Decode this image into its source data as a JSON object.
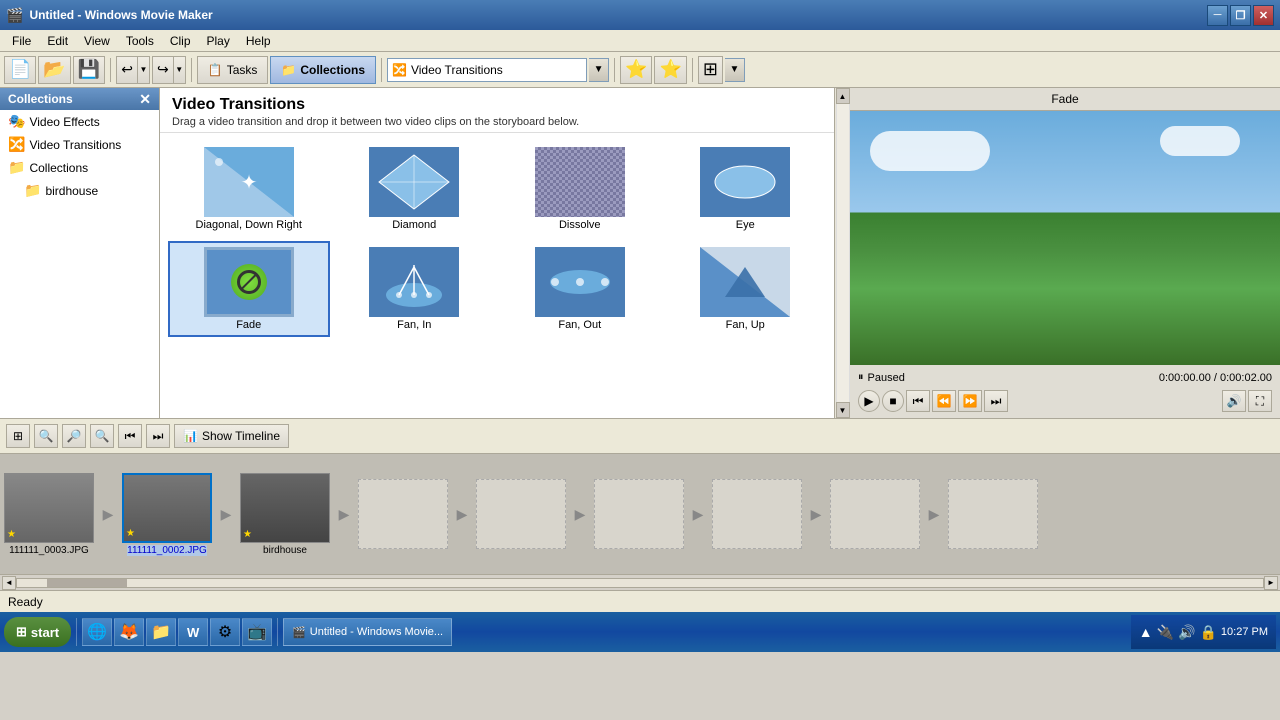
{
  "window": {
    "title": "Untitled - Windows Movie Maker",
    "icon": "🎬"
  },
  "title_bar": {
    "title": "Untitled - Windows Movie Maker",
    "minimize": "─",
    "restore": "❐",
    "close": "✕"
  },
  "menu": {
    "items": [
      "File",
      "Edit",
      "View",
      "Tools",
      "Clip",
      "Play",
      "Help"
    ]
  },
  "toolbar": {
    "tasks_label": "Tasks",
    "collections_label": "Collections",
    "dropdown_value": "Video Transitions",
    "new_icon": "📄",
    "open_icon": "📂",
    "save_icon": "💾",
    "undo_icon": "↩",
    "redo_icon": "↪",
    "import_icon": "⭐",
    "import2_icon": "⭐"
  },
  "left_panel": {
    "title": "Collections",
    "close_icon": "✕",
    "items": [
      {
        "label": "Video Effects",
        "icon": "🎭"
      },
      {
        "label": "Video Transitions",
        "icon": "🔀"
      },
      {
        "label": "Collections",
        "icon": "📁"
      },
      {
        "label": "birdhouse",
        "icon": "📁",
        "indent": true
      }
    ]
  },
  "content_panel": {
    "title": "Video Transitions",
    "description": "Drag a video transition and drop it between two video clips on the storyboard below.",
    "transitions": [
      {
        "id": "diagonal-down-right",
        "label": "Diagonal, Down Right",
        "type": "diagonal"
      },
      {
        "id": "diamond",
        "label": "Diamond",
        "type": "diamond"
      },
      {
        "id": "dissolve",
        "label": "Dissolve",
        "type": "dissolve"
      },
      {
        "id": "eye",
        "label": "Eye",
        "type": "eye"
      },
      {
        "id": "fade",
        "label": "Fade",
        "type": "fade",
        "selected": true
      },
      {
        "id": "fan-in",
        "label": "Fan, In",
        "type": "fan-in"
      },
      {
        "id": "fan-out",
        "label": "Fan, Out",
        "type": "fan-out"
      },
      {
        "id": "fan-up",
        "label": "Fan, Up",
        "type": "fan-up"
      }
    ]
  },
  "preview": {
    "title": "Fade",
    "status": "Paused",
    "time_current": "0:00:00.00",
    "time_total": "0:00:02.00",
    "time_display": "0:00:00.00 / 0:00:02.00"
  },
  "storyboard": {
    "show_timeline_label": "Show Timeline",
    "clips": [
      {
        "label": "111111_0003.JPG",
        "thumb_class": "thumb-img-1",
        "selected": false
      },
      {
        "label": "111111_0002.JPG",
        "thumb_class": "thumb-img-2",
        "selected": true
      },
      {
        "label": "birdhouse",
        "thumb_class": "thumb-img-3",
        "selected": false
      }
    ]
  },
  "status_bar": {
    "text": "Ready"
  },
  "taskbar": {
    "start_label": "start",
    "clock": "10:27 PM",
    "apps": [
      {
        "label": "Untitled - Windows Movie Maker",
        "icon": "🎬"
      }
    ],
    "quick_launch": [
      "🌐",
      "🦊",
      "📄",
      "W",
      "⚙",
      "📺"
    ]
  }
}
